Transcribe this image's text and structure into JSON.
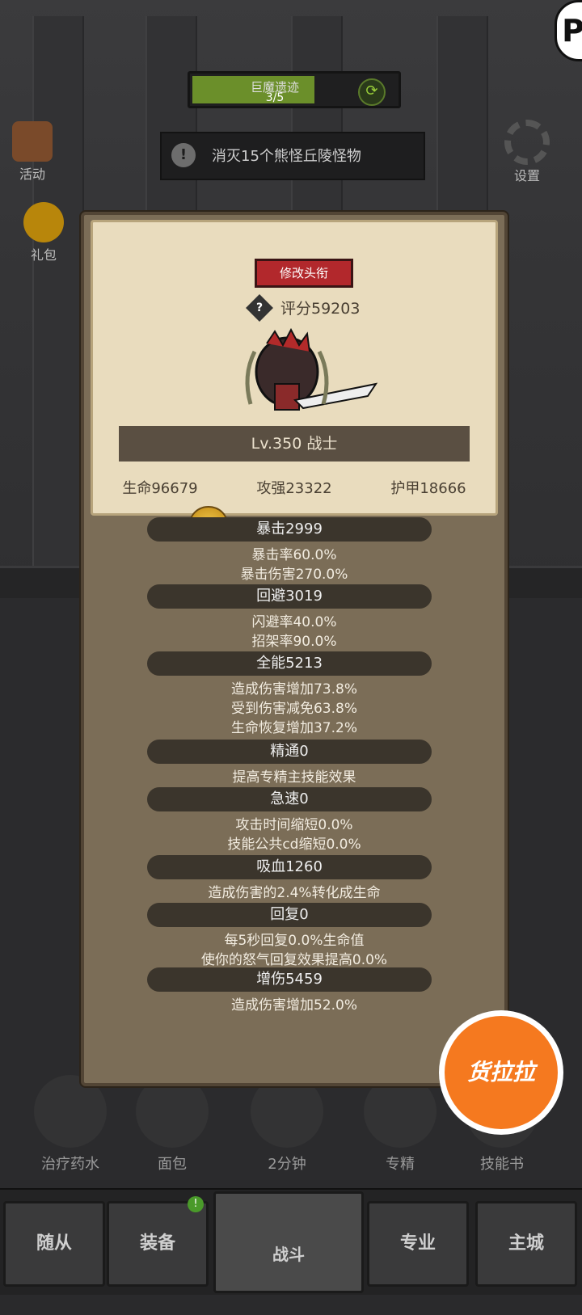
{
  "hud": {
    "quest_title": "巨魔遗迹",
    "quest_progress": "3/5",
    "quest_progress_fraction": 0.6,
    "task_text": "消灭15个熊怪丘陵怪物",
    "side_activity": "活动",
    "side_gift": "礼包",
    "side_settings": "设置",
    "float_button": "货拉拉"
  },
  "panel": {
    "rename_label": "修改头衔",
    "score": "评分59203",
    "level": "Lv.350 战士",
    "hp": "生命96679",
    "attack": "攻强23322",
    "armor": "护甲18666",
    "sections": [
      {
        "title": "暴击2999",
        "lines": [
          "暴击率60.0%",
          "暴击伤害270.0%"
        ]
      },
      {
        "title": "回避3019",
        "lines": [
          "闪避率40.0%",
          "招架率90.0%"
        ]
      },
      {
        "title": "全能5213",
        "lines": [
          "造成伤害增加73.8%",
          "受到伤害减免63.8%",
          "生命恢复增加37.2%"
        ]
      },
      {
        "title": "精通0",
        "lines": [
          "提高专精主技能效果"
        ]
      },
      {
        "title": "急速0",
        "lines": [
          "攻击时间缩短0.0%",
          "技能公共cd缩短0.0%"
        ]
      },
      {
        "title": "吸血1260",
        "lines": [
          "造成伤害的2.4%转化成生命"
        ]
      },
      {
        "title": "回复0",
        "lines": [
          "每5秒回复0.0%生命值",
          "使你的怒气回复效果提高0.0%"
        ]
      },
      {
        "title": "增伤5459",
        "lines": [
          "造成伤害增加52.0%"
        ]
      }
    ]
  },
  "items": {
    "potion": "治疗药水",
    "bread": "面包",
    "chest_timer": "2分钟",
    "spec": "专精",
    "skillbook": "技能书"
  },
  "nav": {
    "followers": "随从",
    "equipment": "装备",
    "fight": "战斗",
    "profession": "专业",
    "city": "主城",
    "badge": "!"
  }
}
